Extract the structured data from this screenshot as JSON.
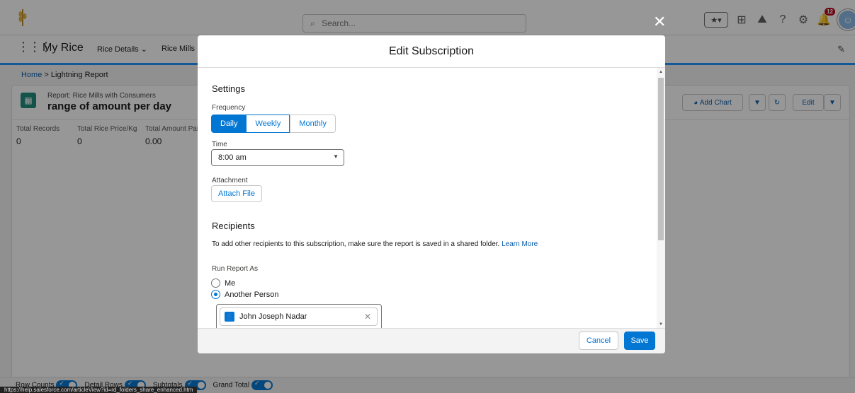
{
  "header": {
    "search_placeholder": "Search...",
    "notification_count": "12"
  },
  "nav": {
    "app_name": "My Rice",
    "items": [
      "Rice Details",
      "Rice Mills"
    ]
  },
  "breadcrumb": {
    "home": "Home",
    "current": "> Lightning Report"
  },
  "report": {
    "kicker": "Report: Rice Mills with Consumers",
    "name": "range of amount per day",
    "toolbar": {
      "add_chart": "Add Chart",
      "edit": "Edit"
    },
    "summary": [
      {
        "label": "Total Records",
        "value": "0"
      },
      {
        "label": "Total Rice Price/Kg",
        "value": "0"
      },
      {
        "label": "Total Amount Paid",
        "value": "0.00"
      }
    ]
  },
  "footer_toggles": [
    "Row Counts",
    "Detail Rows",
    "Subtotals",
    "Grand Total"
  ],
  "status_url": "https://help.salesforce.com/articleView?id=rd_folders_share_enhanced.htm",
  "modal": {
    "title": "Edit Subscription",
    "settings_title": "Settings",
    "frequency_label": "Frequency",
    "frequency_options": [
      "Daily",
      "Weekly",
      "Monthly"
    ],
    "frequency_selected": "Daily",
    "time_label": "Time",
    "time_value": "8:00 am",
    "attachment_label": "Attachment",
    "attach_button": "Attach File",
    "recipients_title": "Recipients",
    "recipients_help": "To add other recipients to this subscription, make sure the report is saved in a shared folder.",
    "learn_more": "Learn More",
    "run_as_label": "Run Report As",
    "run_as_options": [
      "Me",
      "Another Person"
    ],
    "run_as_selected": "Another Person",
    "person_name": "John Joseph Nadar",
    "cancel_label": "Cancel",
    "save_label": "Save"
  },
  "colors": {
    "brand_blue": "#0176d3",
    "overlay": "rgba(8,7,7,0.42)"
  }
}
